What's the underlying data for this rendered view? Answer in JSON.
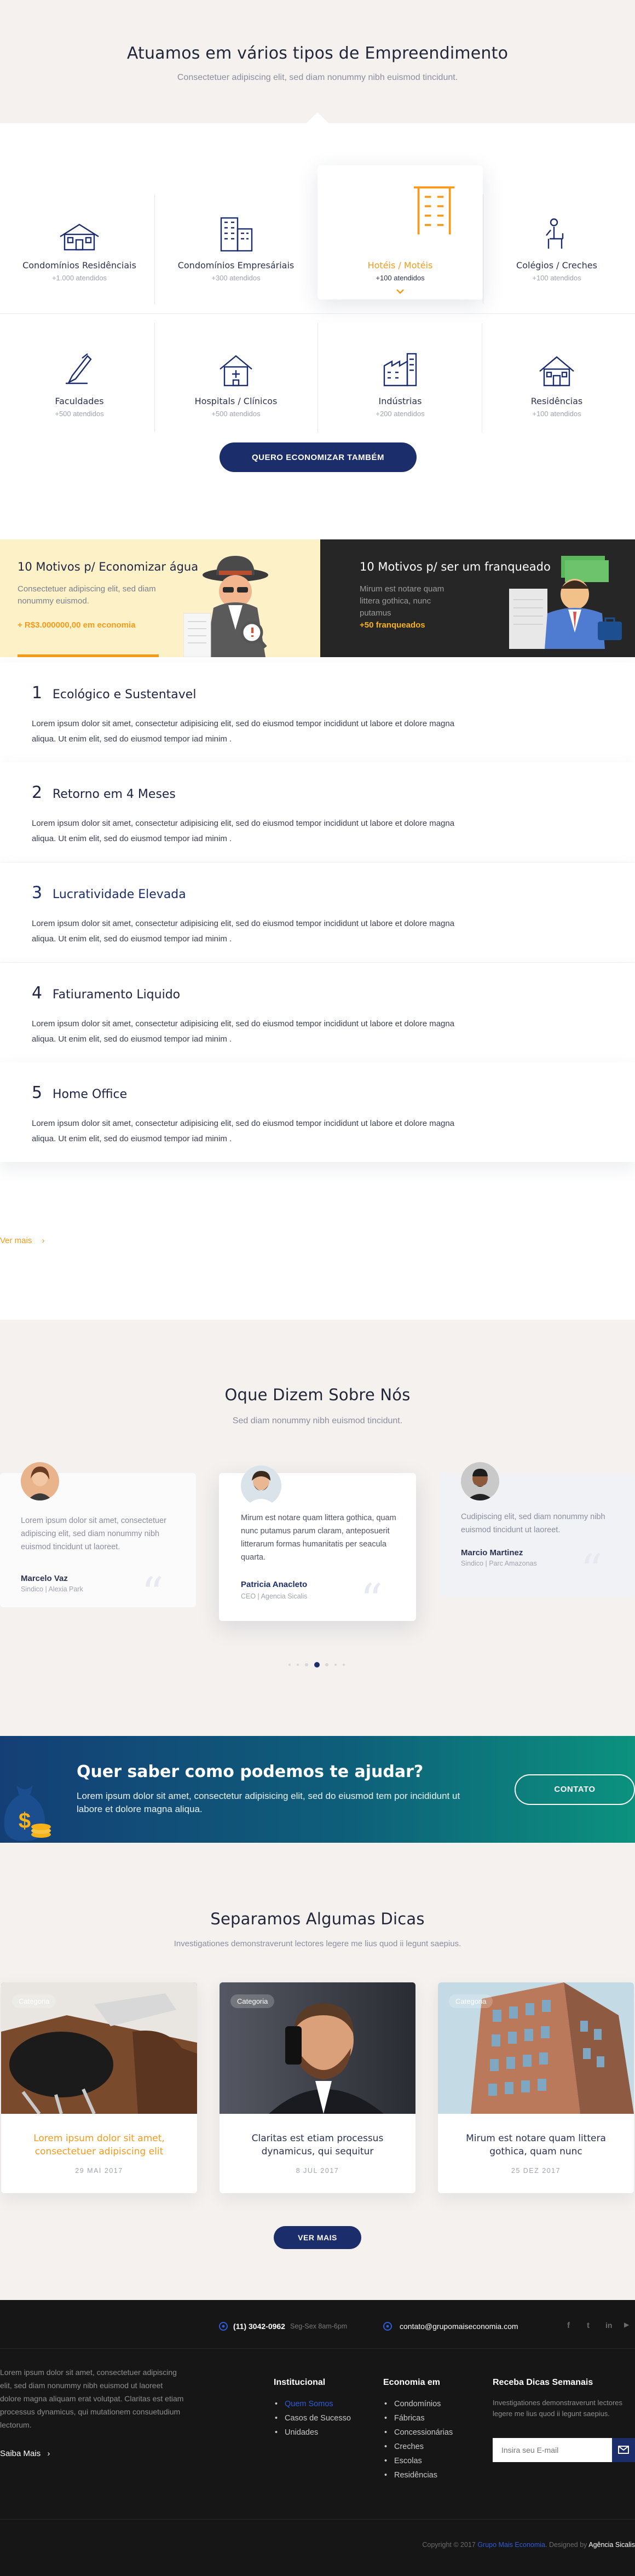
{
  "types": {
    "title": "Atuamos em vários tipos de Empreendimento",
    "subtitle": "Consectetuer adipiscing elit, sed diam nonummy nibh euismod tincidunt.",
    "items": [
      {
        "label": "Condomínios Residênciais",
        "count": "+1.000 atendidos",
        "icon": "house-icon"
      },
      {
        "label": "Condomínios Empresáriais",
        "count": "+300 atendidos",
        "icon": "office-building-icon"
      },
      {
        "label": "Hotéis / Motéis",
        "count": "+100 atendidos",
        "icon": "hotel-icon",
        "active": true
      },
      {
        "label": "Colégios / Creches",
        "count": "+100 atendidos",
        "icon": "school-desk-icon"
      },
      {
        "label": "Faculdades",
        "count": "+500 atendidos",
        "icon": "graduation-pen-icon"
      },
      {
        "label": "Hospitals / Clínicos",
        "count": "+500 atendidos",
        "icon": "hospital-icon"
      },
      {
        "label": "Indústrias",
        "count": "+200 atendidos",
        "icon": "factory-icon"
      },
      {
        "label": "Residências",
        "count": "+100 atendidos",
        "icon": "home-icon"
      }
    ],
    "cta_label": "QUERO ECONOMIZAR TAMBÉM"
  },
  "promo": {
    "left": {
      "title": "10 Motivos p/ Economizar água",
      "text": "Consectetuer adipiscing elit, sed diam nonummy euismod.",
      "highlight": "+ R$3.000000,00 em economia"
    },
    "right": {
      "title": "10 Motivos p/ ser um franqueado",
      "text": "Mirum est notare quam littera gothica, nunc putamus",
      "highlight": "+50 franqueados"
    }
  },
  "reasons": {
    "items": [
      {
        "num": "1",
        "title": "Ecológico e Sustentavel",
        "text": "Lorem ipsum dolor sit amet, consectetur adipisicing elit, sed do eiusmod tempor incididunt ut labore et dolore magna aliqua. Ut enim  elit, sed do eiusmod tempor iad minim ."
      },
      {
        "num": "2",
        "title": "Retorno em 4 Meses",
        "text": "Lorem ipsum dolor sit amet, consectetur adipisicing elit, sed do eiusmod tempor incididunt ut labore et dolore magna aliqua. Ut enim  elit, sed do eiusmod tempor iad minim ."
      },
      {
        "num": "3",
        "title": "Lucratividade Elevada",
        "text": "Lorem ipsum dolor sit amet, consectetur adipisicing elit, sed do eiusmod tempor incididunt ut labore et dolore magna aliqua. Ut enim  elit, sed do eiusmod tempor iad minim ."
      },
      {
        "num": "4",
        "title": "Fatiuramento Liquido",
        "text": "Lorem ipsum dolor sit amet, consectetur adipisicing elit, sed do eiusmod tempor incididunt ut labore et dolore magna aliqua. Ut enim  elit, sed do eiusmod tempor iad minim ."
      },
      {
        "num": "5",
        "title": "Home Office",
        "text": "Lorem ipsum dolor sit amet, consectetur adipisicing elit, sed do eiusmod tempor incididunt ut labore et dolore magna aliqua. Ut enim  elit, sed do eiusmod tempor iad minim ."
      }
    ],
    "more_label": "Ver mais",
    "more_arrow": "›"
  },
  "testimonials": {
    "title": "Oque Dizem Sobre Nós",
    "subtitle": "Sed diam nonummy nibh euismod tincidunt.",
    "items": [
      {
        "text": "Lorem ipsum dolor sit amet, consectetuer adipiscing elit, sed diam nonummy nibh euismod tincidunt ut laoreet.",
        "name": "Marcelo Vaz",
        "role": "Sindico | Alexia Park"
      },
      {
        "text": "Mirum est notare quam littera gothica, quam nunc putamus parum claram, anteposuerit litterarum formas humanitatis per seacula quarta.",
        "name": "Patricia Anacleto",
        "role": "CEO | Agencia Sicalis"
      },
      {
        "text": "Cudipiscing elit, sed diam nonummy nibh euismod tincidunt ut laoreet.",
        "name": "Marcio Martinez",
        "role": "Sindico | Parc Amazonas"
      }
    ],
    "quote_mark": "“"
  },
  "cta": {
    "title": "Quer saber como podemos te ajudar?",
    "text": "Lorem ipsum dolor sit amet, consectetur adipisicing elit, sed do eiusmod tem por incididunt ut labore et dolore magna aliqua.",
    "button": "CONTATO",
    "coin_symbol": "$"
  },
  "tips": {
    "title": "Separamos Algumas Dicas",
    "subtitle": "Investigationes demonstraverunt lectores legere me lius quod ii legunt saepius.",
    "items": [
      {
        "category": "Categoria",
        "title": "Lorem ipsum dolor sit amet, consectetuer adipiscing elit",
        "date": "29 MAI 2017",
        "highlight": true
      },
      {
        "category": "Categoria",
        "title": "Claritas est etiam processus dynamicus, qui sequitur",
        "date": "8 JUL 2017"
      },
      {
        "category": "Categoria",
        "title": "Mirum est notare quam littera gothica, quam nunc",
        "date": "25 DEZ 2017"
      }
    ],
    "more_label": "VER MAIS"
  },
  "footer": {
    "phone": "(11) 3042-0962",
    "phone_hours": "Seg-Sex 8am-6pm",
    "email": "contato@grupomaiseconomia.com",
    "social": {
      "facebook": "f",
      "twitter": "t",
      "linkedin": "in",
      "other": "▶"
    },
    "about": "Lorem ipsum dolor sit amet, consectetuer adipiscing elit, sed diam nonummy nibh euismod ut laoreet dolore magna aliquam erat volutpat. Claritas est etiam processus dynamicus, qui mutationem consuetudium lectorum.",
    "about_more": "Saiba Mais",
    "about_more_arrow": "›",
    "col1": {
      "title": "Institucional",
      "links": [
        "Quem Somos",
        "Casos de Sucesso",
        "Unidades"
      ]
    },
    "col2": {
      "title": "Economia em",
      "links": [
        "Condomínios",
        "Fábricas",
        "Concessionárias",
        "Creches",
        "Escolas",
        "Residências"
      ]
    },
    "newsletter": {
      "title": "Receba Dicas Semanais",
      "text": "Investigationes demonstraverunt lectores legere me lius quod ii legunt saepius.",
      "placeholder": "Insira seu E-mail"
    },
    "copyright_prefix": "Copyright © 2017",
    "copyright_brand": "Grupo Mais Economia",
    "copyright_mid": ". Designed by",
    "copyright_agency": "Agência Sicalis"
  },
  "colors": {
    "navy": "#1c2d6b",
    "orange": "#f59a1b",
    "teal": "#0c927e",
    "dark": "#161616"
  }
}
